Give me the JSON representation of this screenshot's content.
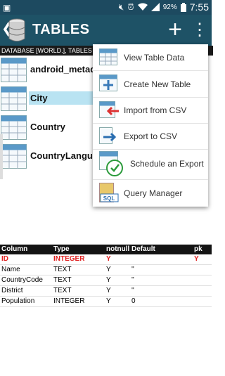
{
  "status_bar": {
    "battery": "92%",
    "time": "7:55",
    "icons": [
      "mute-icon",
      "alarm-icon",
      "wifi-icon",
      "signal-icon",
      "battery-icon"
    ]
  },
  "app_bar": {
    "back": "❮",
    "title": "TABLES",
    "add": "+",
    "overflow": "⋮"
  },
  "breadcrumb": "DATABASE [WORLD.], TABLES",
  "tables": [
    {
      "name": "android_metadata"
    },
    {
      "name": "City"
    },
    {
      "name": "Country"
    },
    {
      "name": "CountryLanguage"
    }
  ],
  "menu": [
    {
      "label": "View Table Data",
      "icon": "table-grid-icon"
    },
    {
      "label": "Create New Table",
      "icon": "table-add-icon"
    },
    {
      "label": "Import from CSV",
      "icon": "csv-import-icon"
    },
    {
      "label": "Export to CSV",
      "icon": "csv-export-icon"
    },
    {
      "label": "Schedule an Export",
      "icon": "clock-icon"
    },
    {
      "label": "Query Manager",
      "icon": "sql-icon"
    }
  ],
  "columns": {
    "headers": [
      "Column",
      "Type",
      "notnull",
      "Default",
      "pk"
    ],
    "rows": [
      {
        "column": "ID",
        "type": "INTEGER",
        "notnull": "Y",
        "default": "",
        "pk": "Y"
      },
      {
        "column": "Name",
        "type": "TEXT",
        "notnull": "Y",
        "default": "''",
        "pk": ""
      },
      {
        "column": "CountryCode",
        "type": "TEXT",
        "notnull": "Y",
        "default": "''",
        "pk": ""
      },
      {
        "column": "District",
        "type": "TEXT",
        "notnull": "Y",
        "default": "''",
        "pk": ""
      },
      {
        "column": "Population",
        "type": "INTEGER",
        "notnull": "Y",
        "default": "0",
        "pk": ""
      }
    ]
  },
  "colors": {
    "app_bar": "#1e5266",
    "status_bar": "#1d4a60",
    "selection": "#b9e3f2",
    "pk_text": "#e02020"
  }
}
